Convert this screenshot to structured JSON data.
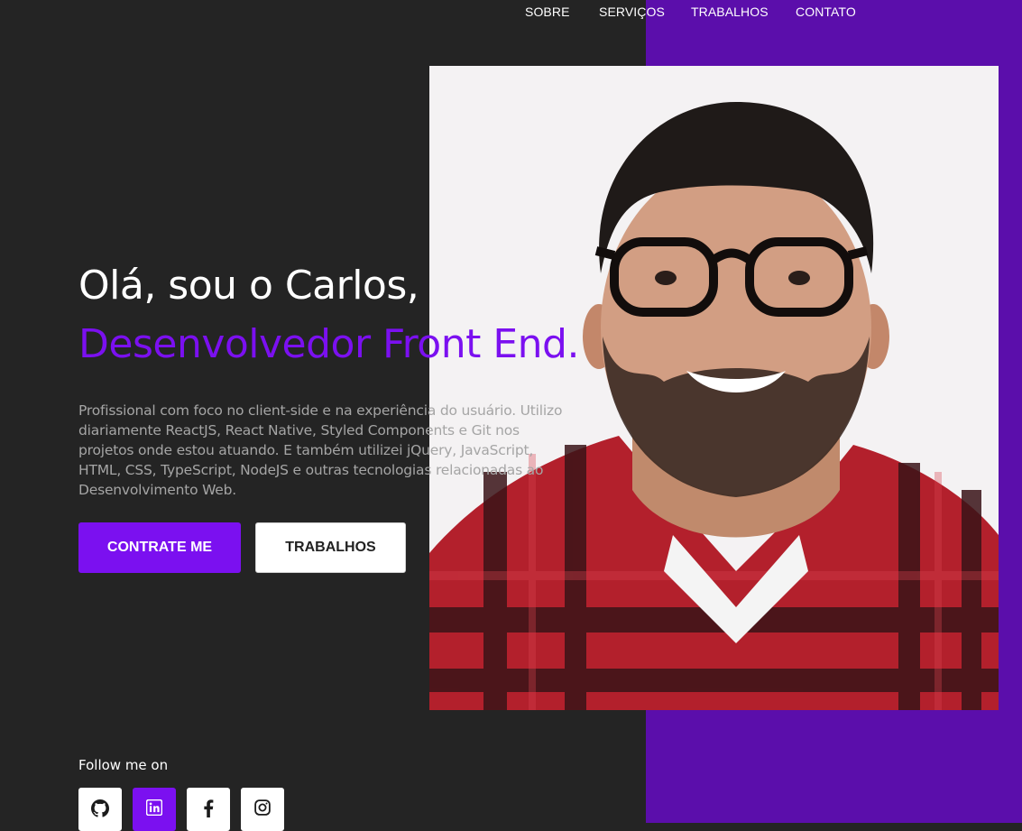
{
  "nav": {
    "items": [
      {
        "label": "SOBRE"
      },
      {
        "label": "SERVIÇOS"
      },
      {
        "label": "TRABALHOS"
      },
      {
        "label": "CONTATO"
      }
    ]
  },
  "hero": {
    "greeting": "Olá, sou o Carlos,",
    "role": "Desenvolvedor Front End.",
    "bio": "Profissional com foco no client-side e na experiência do usuário. Utilizo diariamente ReactJS, React Native, Styled Components e Git nos projetos onde estou atuando. E também utilizei jQuery, JavaScript, HTML, CSS, TypeScript, NodeJS e outras tecnologias relacionadas ao Desenvolvimento Web.",
    "primary_button": "CONTRATE ME",
    "secondary_button": "TRABALHOS",
    "photo_icon": "profile-photo"
  },
  "social": {
    "label": "Follow me on",
    "links": [
      {
        "icon": "github-icon"
      },
      {
        "icon": "linkedin-icon"
      },
      {
        "icon": "facebook-icon"
      },
      {
        "icon": "instagram-icon"
      }
    ]
  },
  "colors": {
    "background": "#242424",
    "accent_panel": "#5b0eab",
    "accent": "#7b10f0",
    "text": "#ffffff",
    "muted_text": "#a5a5a5"
  }
}
